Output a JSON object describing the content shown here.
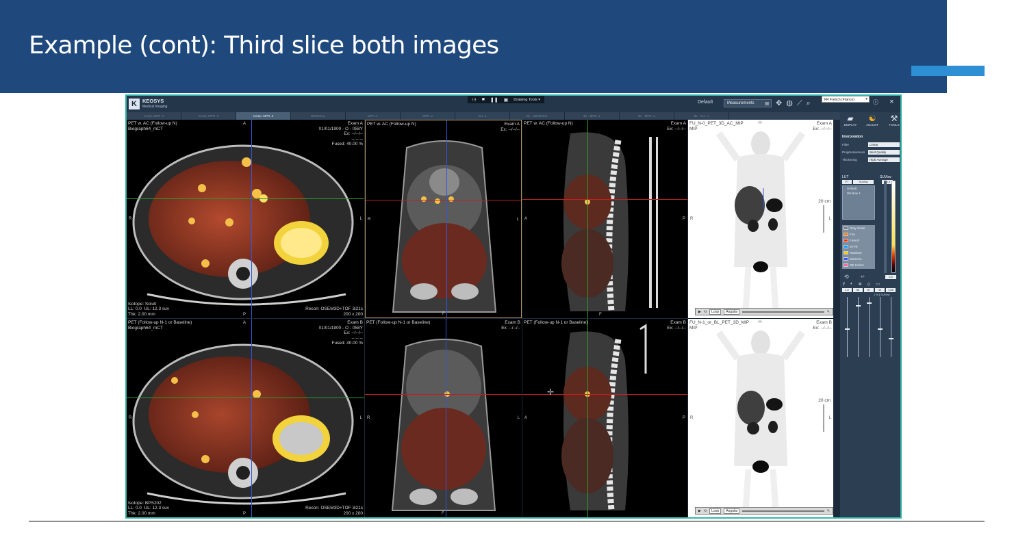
{
  "slide": {
    "title": "Example (cont): Third slice both images"
  },
  "colors": {
    "header_bg": "#1f497d",
    "accent_bar": "#2e8fd4",
    "app_border": "#34b7a7",
    "app_bg": "#1b2a3a"
  },
  "app": {
    "logo_text": "KEOSYS",
    "logo_sub": "Medical Imaging",
    "drawing_tools": "Drawing Tools ▾",
    "preset": "Default",
    "measurements": "Measurements",
    "language": "FR French (France)",
    "tabs": [
      "Comp. MPR .1",
      "Comp. MPR .2",
      "Comp. MPR .3",
      "GENERAL",
      "MPR .1",
      "MPR .2",
      "ALL .1",
      "BL - GENERAL",
      "BL - MPR .1",
      "BL - MPR .2",
      "BL - ALL .1"
    ],
    "active_tab_index": 2
  },
  "viewports": {
    "row1": {
      "axial": {
        "label_tl": "PET w. AC (Follow-up N)\nBiograph64_mCT",
        "label_tr": "Exam A\n01/01/1900 - O - 058Y\nEx: --/--/--\n--:--:--\nFused: 40.00 %",
        "label_bl": "Isotope: Soluti\nLL: 0.0  UL: 12.3 suv\nThk: 2.00 mm",
        "label_br": "Recon: OSEM3D+TOF 3i21s\n200 x 200"
      },
      "coronal": {
        "label_tl": "PET w. AC (Follow-up N)",
        "label_tr": "Exam A\nEx: --/--/--"
      },
      "sagittal": {
        "label_tl": "PET w. AC (Follow-up N)",
        "label_tr": "Exam A\nEx: --/--/--"
      },
      "mip": {
        "label_tl": "FU_N-0_PET_3D_AC_MIP\nMIP",
        "label_tr": "Exam A\nEx: --/--/--",
        "scale": "20 cm",
        "cine_mode": "Loop",
        "cine_type": "Angular"
      }
    },
    "row2": {
      "axial": {
        "label_tl": "PET (Follow-up N-1 or Baseline)\nBiograph64_mCT",
        "label_tr": "Exam B\n01/01/1900 - O - 058Y\nEx: --/--/--\n--:--:--\nFused: 40.00 %",
        "label_bl": "Isotope: BPS202\nLL: 0.0  UL: 12.3 suv\nThk: 2.00 mm",
        "label_br": "Recon: OSEM3D+TOF 3i21s\n200 x 200"
      },
      "coronal": {
        "label_tl": "PET (Follow-up N-1 or Baseline)",
        "label_tr": "Exam B\nEx: --/--/--"
      },
      "sagittal": {
        "label_tl": "PET (Follow-up N-1 or Baseline)",
        "label_tr": "Exam B\nEx: --/--/--"
      },
      "mip": {
        "label_tl": "FU_N-1_or_BL_PET_3D_MIP\nMIP",
        "label_tr": "Exam B\nEx: --/--/--",
        "scale": "20 cm",
        "cine_mode": "Loop",
        "cine_type": "Angular"
      }
    },
    "orientation": {
      "anterior": "A",
      "posterior": "P",
      "right": "R",
      "left": "L",
      "foot": "F",
      "head": "H"
    }
  },
  "side_panel": {
    "buttons": [
      "DISPLAY",
      "ADJUST",
      "TOOLS"
    ],
    "interpolation_title": "Interpolation",
    "filter_label": "Filter",
    "filter_value": "Linear",
    "progressiveness_label": "Progressiveness",
    "progressiveness_value": "Best Quality",
    "thickening_label": "Thickening",
    "thickening_value": "High Average",
    "lut_title": "LUT",
    "lut_unit": "SUVbw",
    "lut_modality": "PT",
    "lut_unit_select": "SUVbw",
    "lut_max": "12.3",
    "lut_min": "0.0",
    "lut_items": [
      "Default",
      "Window 1"
    ],
    "colormaps": [
      "Gray Scale",
      "Fire",
      "French",
      "STFR",
      "Rainbow",
      "Siemens",
      "GE Colors"
    ],
    "colormap_colors": [
      "#808080",
      "#ff7a00",
      "#ff3300",
      "#00a0ff",
      "#ffcc00",
      "#3355ff",
      "#ff6699"
    ],
    "invert_label": "+/-",
    "values": [
      "1.0",
      "55",
      "87",
      "40",
      "1.65"
    ],
    "units": "[ % ]   SUVbw"
  }
}
